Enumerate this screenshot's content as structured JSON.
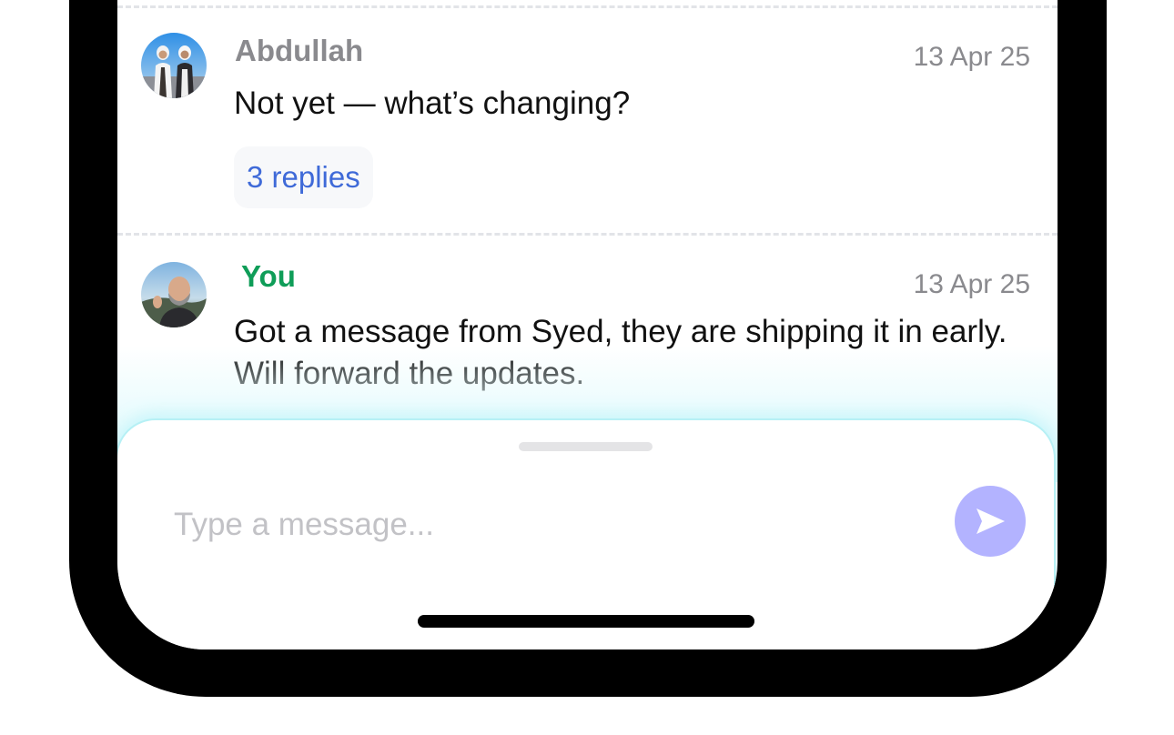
{
  "messages": [
    {
      "sender": "Abdullah",
      "timestamp": "13 Apr 25",
      "text": "Not yet — what’s changing?",
      "replies_label": "3 replies"
    },
    {
      "sender": "You",
      "timestamp": "13 Apr 25",
      "text": "Got a message from Syed, they are shipping it in early. Will forward the updates."
    }
  ],
  "composer": {
    "placeholder": "Type a message...",
    "send_icon": "send-arrow-icon"
  },
  "colors": {
    "self_sender": "#0f9d58",
    "other_sender": "#8a8a8e",
    "replies_link": "#3f6ad8",
    "send_button": "#b3b3ff"
  }
}
